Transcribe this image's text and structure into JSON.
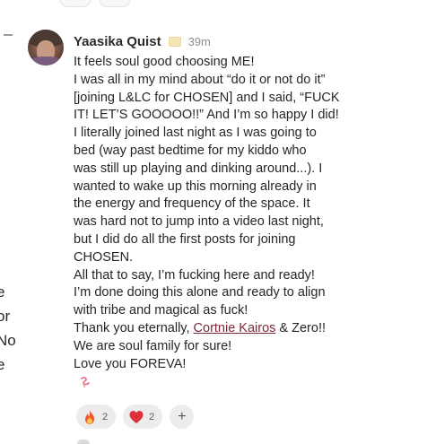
{
  "comment": {
    "author": "Yaasika Quist",
    "badge_icon": "badge-icon",
    "time": "39m",
    "lines": [
      "It feels soul good choosing ME!",
      "I was all in my mind about “do it or not do it”",
      "[joining L&LC for CHOSEN] and I said, “FUCK",
      "IT! LET’S GOOOOO!!” And I’m so happy I did!",
      "I literally joined last night as I was going to",
      "bed (way past bedtime for my kiddo who",
      "was still up playing and dinking around...). I",
      "wanted to wake up this morning already in",
      "the energy and frequency of the space. It",
      "was hard not to jump into a video last night,",
      "but I did do all the first posts for joining",
      "CHOSEN.",
      "All that to say, I’m fucking here and ready!",
      "I’m done doing this alone and ready to align",
      "with tribe and magical as fuck!"
    ],
    "thanks_prefix": "Thank you eternally, ",
    "mention": "Cortnie Kairos",
    "thanks_suffix": " & Zero!!",
    "closing_lines": [
      "We are soul family for sure!",
      "Love you FOREVA!"
    ],
    "flag_icon": "flamingo-icon",
    "reactions": [
      {
        "icon": "fire-emoji-icon",
        "count": "2"
      },
      {
        "icon": "heart-emoji-icon",
        "count": "2"
      }
    ],
    "add_reaction_label": "+"
  },
  "left_edge_text": [
    "e",
    "or",
    "No",
    "e"
  ],
  "colors": {
    "mention": "#7b2a3a",
    "pill_bg": "#ececec",
    "time": "#8c8c8c"
  }
}
